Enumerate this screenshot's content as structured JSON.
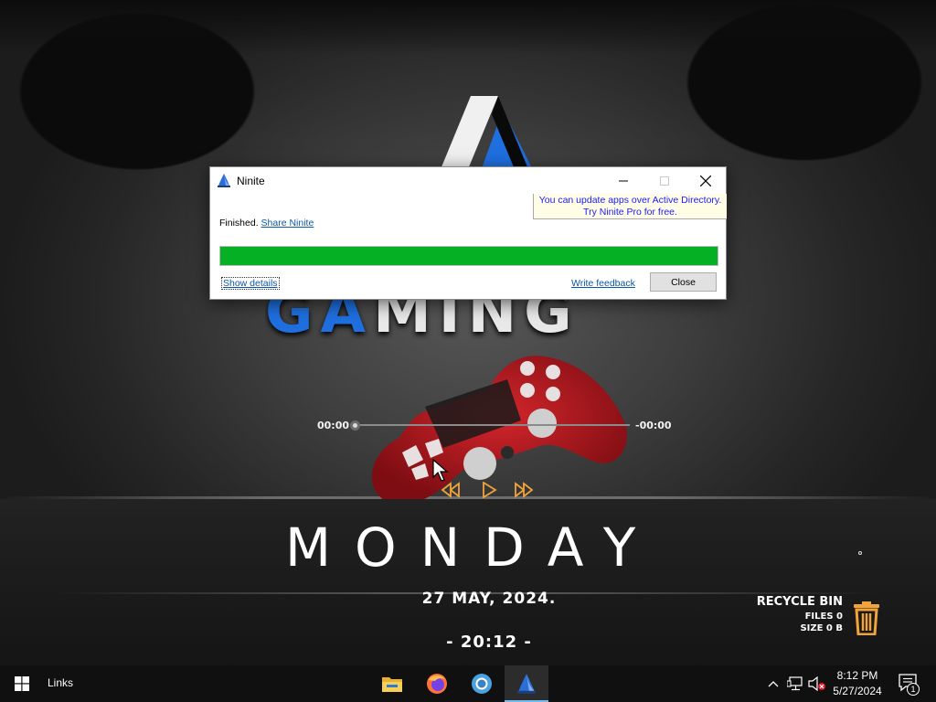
{
  "ninite": {
    "title": "Ninite",
    "status": "Finished.",
    "share_link": "Share Ninite",
    "pro_banner_line1": "You can update apps over Active Directory.",
    "pro_banner_line2": "Try Ninite Pro for free.",
    "progress_fraction": 1.0,
    "progress_color": "#06b025",
    "show_details": "Show details",
    "write_feedback": "Write feedback",
    "close_button": "Close"
  },
  "wallpaper": {
    "logo_word_left": "GA",
    "logo_word_right": "MING",
    "media_time_elapsed": "00:00",
    "media_time_remaining": "-00:00",
    "day": "MONDAY",
    "date": "27  MAY,  2024.",
    "time": "- 20:12 -",
    "recycle_bin": {
      "title": "RECYCLE BIN",
      "files": "FILES 0",
      "size": "SIZE 0 B"
    },
    "accent_orange": "#f2a33a"
  },
  "taskbar": {
    "links_label": "Links",
    "apps": [
      {
        "name": "file-explorer",
        "icon": "folder-icon"
      },
      {
        "name": "firefox",
        "icon": "firefox-icon"
      },
      {
        "name": "chrome",
        "icon": "chrome-icon"
      },
      {
        "name": "ninite",
        "icon": "ninite-icon",
        "active": true
      }
    ],
    "clock_time": "8:12 PM",
    "clock_date": "5/27/2024",
    "notification_count": "1"
  }
}
